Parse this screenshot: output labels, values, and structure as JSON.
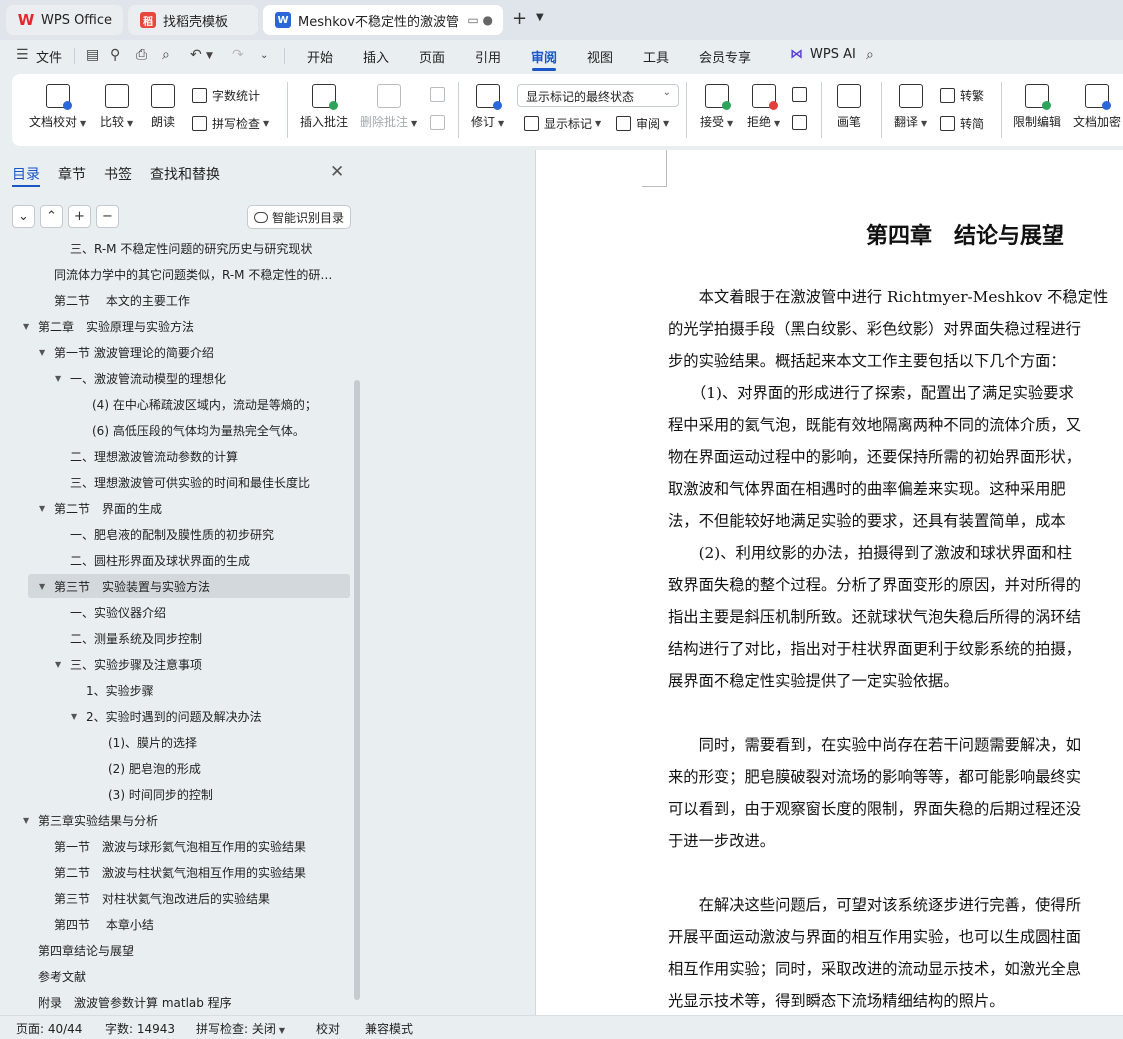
{
  "tabs": [
    {
      "label": "WPS Office",
      "icon": "wps-logo-icon"
    },
    {
      "label": "找稻壳模板",
      "icon": "docer-icon"
    },
    {
      "label": "Meshkov不稳定性的激波管实",
      "icon": "writer-doc-icon",
      "active": true
    }
  ],
  "menubar": {
    "file": "文件",
    "items": [
      "开始",
      "插入",
      "页面",
      "引用",
      "审阅",
      "视图",
      "工具",
      "会员专享"
    ],
    "active": "审阅",
    "wps_ai": "WPS AI"
  },
  "ribbon": {
    "doc_proofread": "文档校对",
    "compare": "比较",
    "read_aloud": "朗读",
    "word_count": "字数统计",
    "spell_check": "拼写检查",
    "insert_comment": "插入批注",
    "delete_comment": "删除批注",
    "track_changes": "修订",
    "markup_state": "显示标记的最终状态",
    "show_markup": "显示标记",
    "review_pane": "审阅",
    "accept": "接受",
    "reject": "拒绝",
    "pen": "画笔",
    "translate": "翻译",
    "to_traditional": "转繁",
    "to_simplified": "转简",
    "restrict_editing": "限制编辑",
    "encrypt": "文档加密"
  },
  "nav": {
    "tabs": [
      "目录",
      "章节",
      "书签",
      "查找和替换"
    ],
    "active_tab": "目录",
    "smart_toc": "智能识别目录",
    "toc": [
      {
        "label": "三、R-M 不稳定性问题的研究历史与研究现状",
        "level": 3
      },
      {
        "label": "同流体力学中的其它问题类似，R-M 不稳定性的研…",
        "level": 2
      },
      {
        "label": "第二节　 本文的主要工作",
        "level": 2
      },
      {
        "label": "第二章　实验原理与实验方法",
        "level": 1,
        "expand": "expanded"
      },
      {
        "label": "第一节  激波管理论的简要介绍",
        "level": 2,
        "expand": "expanded"
      },
      {
        "label": "一、激波管流动模型的理想化",
        "level": 3,
        "expand": "expanded"
      },
      {
        "label": "(4)  在中心稀疏波区域内，流动是等熵的；",
        "level": 4
      },
      {
        "label": "(6)  高低压段的气体均为量热完全气体。",
        "level": 4
      },
      {
        "label": "二、理想激波管流动参数的计算",
        "level": 3
      },
      {
        "label": "三、理想激波管可供实验的时间和最佳长度比",
        "level": 3
      },
      {
        "label": "第二节　界面的生成",
        "level": 2,
        "expand": "expanded"
      },
      {
        "label": "一、肥皂液的配制及膜性质的初步研究",
        "level": 3
      },
      {
        "label": "二、圆柱形界面及球状界面的生成",
        "level": 3
      },
      {
        "label": "第三节　实验装置与实验方法",
        "level": 2,
        "expand": "expanded",
        "selected": true
      },
      {
        "label": "一、实验仪器介绍",
        "level": 3
      },
      {
        "label": "二、测量系统及同步控制",
        "level": 3
      },
      {
        "label": "三、实验步骤及注意事项",
        "level": 3,
        "expand": "expanded"
      },
      {
        "label": "1、实验步骤",
        "level": 4
      },
      {
        "label": "2、实验时遇到的问题及解决办法",
        "level": 4,
        "expand": "expanded"
      },
      {
        "label": "(1)、膜片的选择",
        "level": 5
      },
      {
        "label": "(2)  肥皂泡的形成",
        "level": 5
      },
      {
        "label": "(3)  时间同步的控制",
        "level": 5
      },
      {
        "label": "第三章实验结果与分析",
        "level": 1,
        "expand": "expanded"
      },
      {
        "label": "第一节　激波与球形氦气泡相互作用的实验结果",
        "level": 2
      },
      {
        "label": "第二节　激波与柱状氦气泡相互作用的实验结果",
        "level": 2
      },
      {
        "label": "第三节　对柱状氦气泡改进后的实验结果",
        "level": 2
      },
      {
        "label": "第四节　 本章小结",
        "level": 2
      },
      {
        "label": "第四章结论与展望",
        "level": 1
      },
      {
        "label": "参考文献",
        "level": 1
      },
      {
        "label": "附录　激波管参数计算 matlab 程序",
        "level": 1
      }
    ]
  },
  "document": {
    "chapter_title": "第四章　结论与展望",
    "paragraphs": [
      "　　本文着眼于在激波管中进行 Richtmyer-Meshkov 不稳定性",
      "的光学拍摄手段（黑白纹影、彩色纹影）对界面失稳过程进行",
      "步的实验结果。概括起来本文工作主要包括以下几个方面：",
      "　　（1)、对界面的形成进行了探索，配置出了满足实验要求",
      "程中采用的氦气泡，既能有效地隔离两种不同的流体介质，又",
      "物在界面运动过程中的影响，还要保持所需的初始界面形状，",
      "取激波和气体界面在相遇时的曲率偏差来实现。这种采用肥",
      "法，不但能较好地满足实验的要求，还具有装置简单，成本",
      "　　(2)、利用纹影的办法，拍摄得到了激波和球状界面和柱",
      "致界面失稳的整个过程。分析了界面变形的原因，并对所得的",
      "指出主要是斜压机制所致。还就球状气泡失稳后所得的涡环结",
      "结构进行了对比，指出对于柱状界面更利于纹影系统的拍摄，",
      "展界面不稳定性实验提供了一定实验依据。",
      "",
      "　　同时，需要看到，在实验中尚存在若干问题需要解决，如",
      "来的形变；肥皂膜破裂对流场的影响等等，都可能影响最终实",
      "可以看到，由于观察窗长度的限制，界面失稳的后期过程还没",
      "于进一步改进。",
      "",
      "　　在解决这些问题后，可望对该系统逐步进行完善，使得所",
      "开展平面运动激波与界面的相互作用实验，也可以生成圆柱面",
      "相互作用实验；同时，采取改进的流动显示技术，如激光全息",
      "光显示技术等，得到瞬态下流场精细结构的照片。"
    ]
  },
  "status": {
    "page": "页面: 40/44",
    "words": "字数: 14943",
    "spell": "拼写检查: 关闭",
    "proof": "校对",
    "compat": "兼容模式"
  },
  "colors": {
    "accent": "#1a56c8",
    "chrome": "#e9eef1",
    "selected_row": "#d3d8dc"
  }
}
